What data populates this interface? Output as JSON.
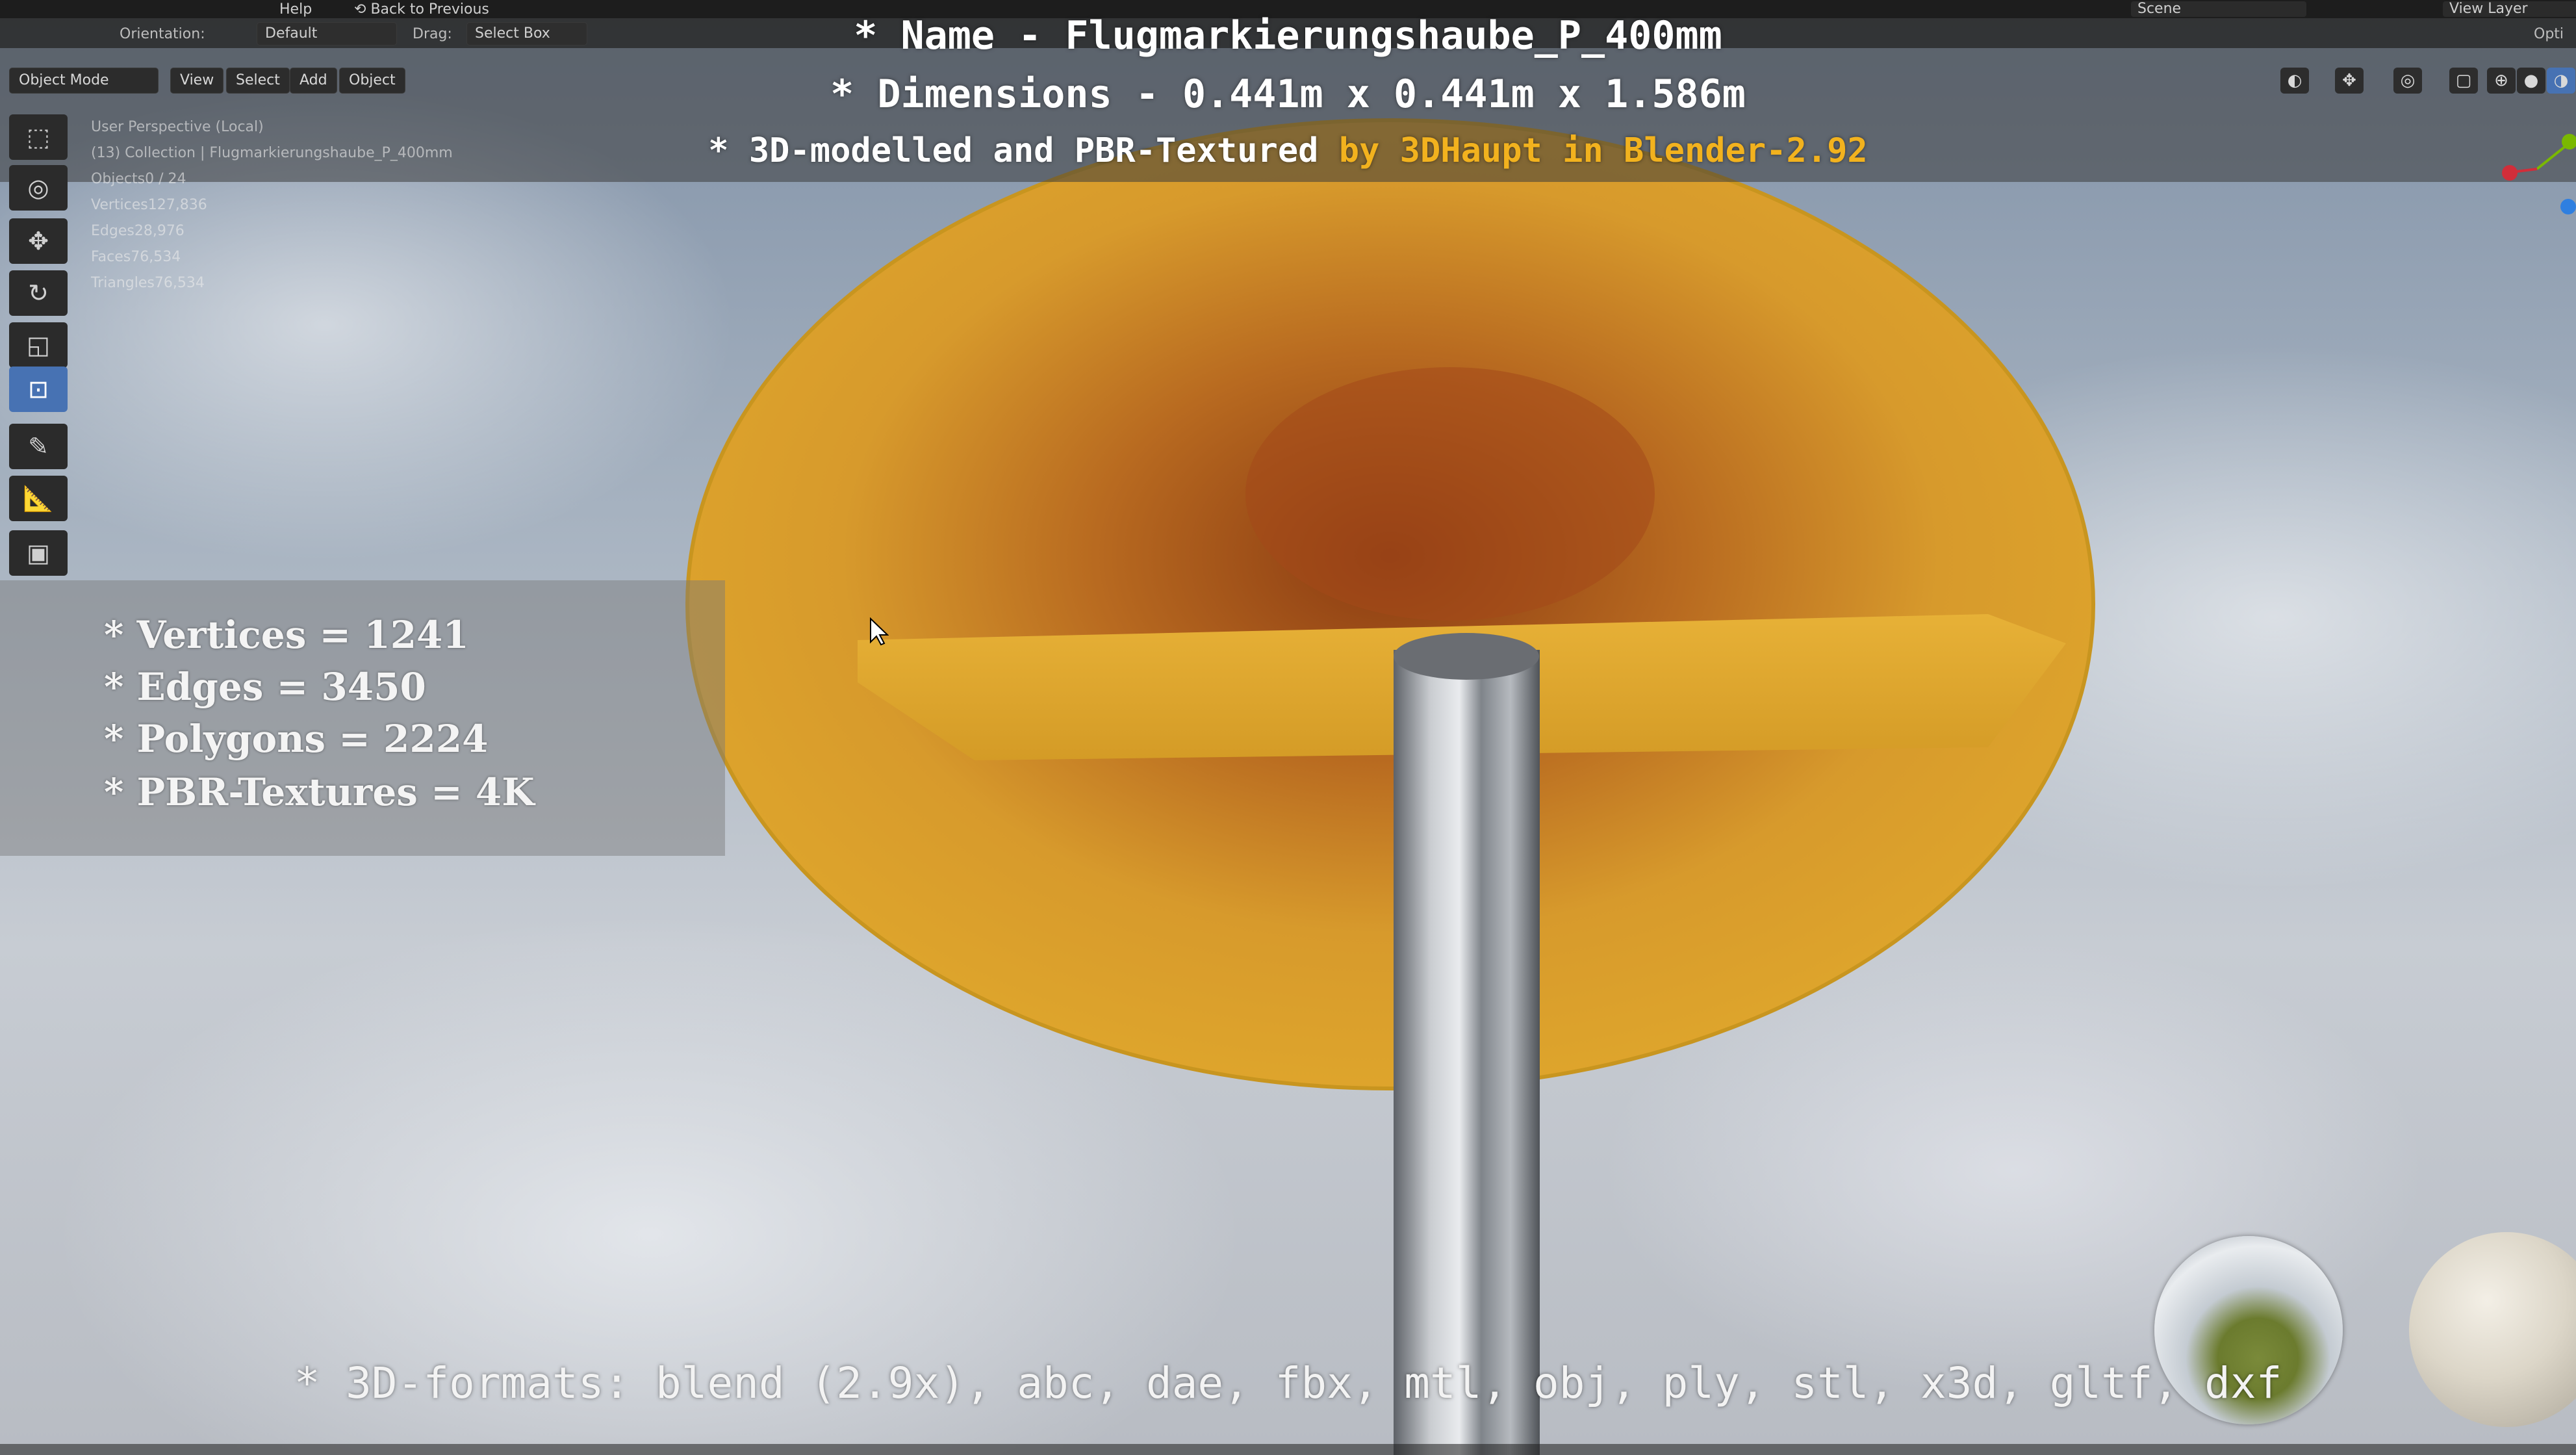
{
  "header": {
    "menu_help": "Help",
    "back_to_previous": "Back to Previous",
    "scene": "Scene",
    "view_layer": "View Layer"
  },
  "toolbar": {
    "orientation_label": "Orientation:",
    "orientation_value": "Default",
    "drag_label": "Drag:",
    "drag_value": "Select Box",
    "options_label": "Opti"
  },
  "mode_row": {
    "object_mode": "Object Mode",
    "view": "View",
    "select": "Select",
    "add": "Add",
    "object": "Object"
  },
  "viewport_info": {
    "perspective": "User Perspective (Local)",
    "collection": "(13) Collection | Flugmarkierungshaube_P_400mm"
  },
  "stats": [
    {
      "label": "Objects",
      "value": "0 / 24"
    },
    {
      "label": "Vertices",
      "value": "127,836"
    },
    {
      "label": "Edges",
      "value": "28,976"
    },
    {
      "label": "Faces",
      "value": "76,534"
    },
    {
      "label": "Triangles",
      "value": "76,534"
    }
  ],
  "overlay": {
    "name_line": "* Name - Flugmarkierungshaube_P_400mm",
    "dimensions_line": "* Dimensions -  0.441m x 0.441m x 1.586m",
    "credit_prefix": "* 3D-modelled and PBR-Textured ",
    "credit_highlight": "by 3DHaupt in Blender-2.92",
    "vertices": "* Vertices = 1241",
    "edges": "* Edges = 3450",
    "polygons": "* Polygons = 2224",
    "textures": "* PBR-Textures = 4K",
    "formats": "* 3D-formats: blend (2.9x), abc, dae, fbx, mtl, obj, ply, stl, x3d, gltf, dxf"
  },
  "colors": {
    "highlight": "#f2b21e",
    "cone_yellow": "#e0a82c",
    "active_tool": "#4772b3"
  },
  "icons": [
    "select-box-icon",
    "cursor-icon",
    "move-icon",
    "rotate-icon",
    "scale-icon",
    "transform-icon",
    "annotate-icon",
    "measure-icon",
    "add-cube-icon"
  ]
}
